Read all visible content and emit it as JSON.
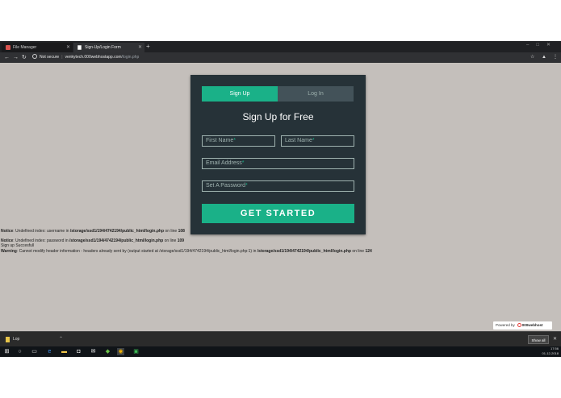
{
  "browser": {
    "tabs": [
      {
        "title": "File Manager"
      },
      {
        "title": "Sign-Up/Login Form"
      }
    ],
    "new_tab": "+",
    "window_controls": "–□✕",
    "address": {
      "security": "Not secure",
      "host": "venkytech.000webhostapp.com",
      "path": "/login.php"
    }
  },
  "form": {
    "tab_signup": "Sign Up",
    "tab_login": "Log In",
    "title": "Sign Up for Free",
    "first_name": "First Name",
    "last_name": "Last Name",
    "email": "Email Address",
    "password": "Set A Password",
    "required_mark": "*",
    "submit": "Get Started",
    "colors": {
      "accent": "#1ab188",
      "panel": "#263238",
      "inactive_tab": "#435259"
    }
  },
  "php_output": {
    "notice1": {
      "label": "Notice",
      "text": ": Undefined index: username in ",
      "file": "/storage/ssd1/194/4742194/public_html/login.php",
      "on_line": " on line ",
      "line": "108"
    },
    "notice2": {
      "label": "Notice",
      "text": ": Undefined index: password in ",
      "file": "/storage/ssd1/194/4742194/public_html/login.php",
      "on_line": " on line ",
      "line": "109"
    },
    "success": "Sign up Succesfull",
    "warning": {
      "label": "Warning",
      "text": ": Cannot modify header information - headers already sent by (output started at /storage/ssd1/194/4742194/public_html/login.php:1) in ",
      "file": "/storage/ssd1/194/4742194/public_html/login.php",
      "on_line": " on line ",
      "line": "124"
    }
  },
  "powered": {
    "prefix": "Powered by",
    "brand": "000webhost"
  },
  "download_bar": {
    "file": "Lop",
    "show_all": "Show all"
  },
  "taskbar": {
    "time": "17:56",
    "date": "01-12-2018"
  }
}
